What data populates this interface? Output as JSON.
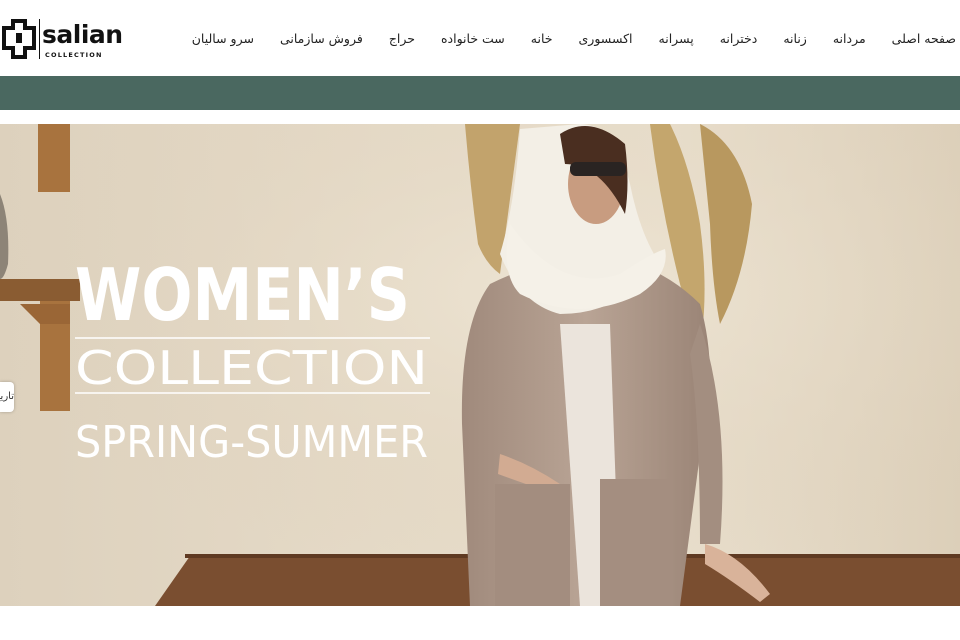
{
  "brand": {
    "name": "salian",
    "sub": "COLLECTION"
  },
  "nav": {
    "items": [
      {
        "label": "صفحه اصلی",
        "key": "home"
      },
      {
        "label": "مردانه",
        "key": "men"
      },
      {
        "label": "زنانه",
        "key": "women"
      },
      {
        "label": "دخترانه",
        "key": "girls"
      },
      {
        "label": "پسرانه",
        "key": "boys"
      },
      {
        "label": "اکسسوری",
        "key": "accessories"
      },
      {
        "label": "خانه",
        "key": "house"
      },
      {
        "label": "ست خانواده",
        "key": "family-set"
      },
      {
        "label": "حراج",
        "key": "sale"
      },
      {
        "label": "فروش سازمانی",
        "key": "corporate-sales"
      },
      {
        "label": "سرو سالیان",
        "key": "sarv-salian"
      }
    ]
  },
  "colors": {
    "bar": "#4a6860",
    "hero_text": "#ffffff"
  },
  "hero": {
    "line1": "WOMEN’S",
    "line2": "COLLECTION",
    "line3": "SPRING-SUMMER"
  },
  "side_tab": {
    "label": "تاریخ"
  }
}
